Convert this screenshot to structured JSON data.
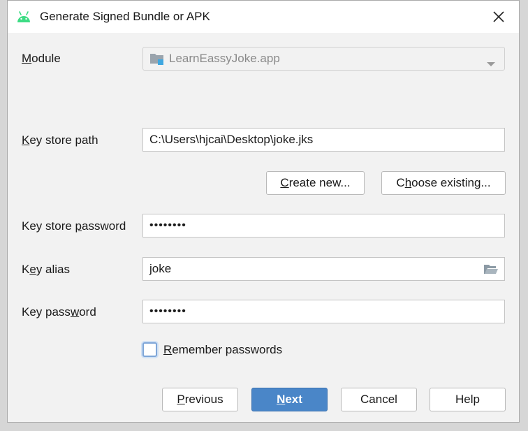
{
  "window": {
    "title": "Generate Signed Bundle or APK"
  },
  "form": {
    "module": {
      "label_pre": "",
      "label_mnemonic": "M",
      "label_post": "odule",
      "value": "LearnEassyJoke.app"
    },
    "key_store_path": {
      "label_pre": "",
      "label_mnemonic": "K",
      "label_post": "ey store path",
      "value": "C:\\Users\\hjcai\\Desktop\\joke.jks"
    },
    "key_store_password": {
      "label_pre": "Key store ",
      "label_mnemonic": "p",
      "label_post": "assword",
      "value": "••••••••"
    },
    "key_alias": {
      "label_pre": "K",
      "label_mnemonic": "e",
      "label_post": "y alias",
      "value": "joke"
    },
    "key_password": {
      "label_pre": "Key pass",
      "label_mnemonic": "w",
      "label_post": "ord",
      "value": "••••••••"
    },
    "remember": {
      "label_pre": "",
      "label_mnemonic": "R",
      "label_post": "emember passwords",
      "checked": false
    }
  },
  "buttons": {
    "create_new": {
      "pre": "",
      "mn": "C",
      "post": "reate new..."
    },
    "choose_existing": {
      "pre": "C",
      "mn": "h",
      "post": "oose existing..."
    },
    "previous": {
      "pre": "",
      "mn": "P",
      "post": "revious"
    },
    "next": {
      "pre": "",
      "mn": "N",
      "post": "ext"
    },
    "cancel": {
      "label": "Cancel"
    },
    "help": {
      "label": "Help"
    }
  },
  "colors": {
    "primary_button": "#4a86c8",
    "android_green": "#3ddc84"
  },
  "icons": {
    "app": "android-icon",
    "close": "close-icon",
    "module": "module-folder-icon",
    "dropdown": "chevron-down-icon",
    "browse": "folder-open-icon"
  }
}
